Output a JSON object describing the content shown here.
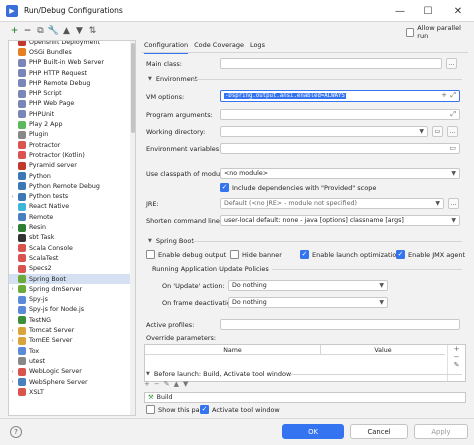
{
  "window": {
    "title": "Run/Debug Configurations",
    "minimize": "—",
    "maximize": "☐",
    "close": "✕"
  },
  "toolbar": {
    "add": "+",
    "remove": "−",
    "copy": "⧉",
    "settings": "🔧",
    "move_up": "▲",
    "move_down": "▼",
    "sort": "⇅"
  },
  "tree": {
    "items": [
      {
        "label": "Openshift Deployment",
        "color": "#c0392b",
        "arrow": ""
      },
      {
        "label": "OSGi Bundles",
        "color": "#e67e22",
        "arrow": ""
      },
      {
        "label": "PHP Built-in Web Server",
        "color": "#7a86b8",
        "arrow": ""
      },
      {
        "label": "PHP HTTP Request",
        "color": "#7a86b8",
        "arrow": ""
      },
      {
        "label": "PHP Remote Debug",
        "color": "#7a86b8",
        "arrow": ""
      },
      {
        "label": "PHP Script",
        "color": "#7a86b8",
        "arrow": ""
      },
      {
        "label": "PHP Web Page",
        "color": "#7a86b8",
        "arrow": ""
      },
      {
        "label": "PHPUnit",
        "color": "#7a86b8",
        "arrow": ""
      },
      {
        "label": "Play 2 App",
        "color": "#5cb85c",
        "arrow": ""
      },
      {
        "label": "Plugin",
        "color": "#888888",
        "arrow": ""
      },
      {
        "label": "Protractor",
        "color": "#d9534f",
        "arrow": ""
      },
      {
        "label": "Protractor (Kotlin)",
        "color": "#d9534f",
        "arrow": ""
      },
      {
        "label": "Pyramid server",
        "color": "#c0392b",
        "arrow": ""
      },
      {
        "label": "Python",
        "color": "#3b78b5",
        "arrow": ""
      },
      {
        "label": "Python Remote Debug",
        "color": "#3b78b5",
        "arrow": ""
      },
      {
        "label": "Python tests",
        "color": "#3b78b5",
        "arrow": "›"
      },
      {
        "label": "React Native",
        "color": "#3fb6d9",
        "arrow": ""
      },
      {
        "label": "Remote",
        "color": "#4a7fbf",
        "arrow": ""
      },
      {
        "label": "Resin",
        "color": "#2e7d32",
        "arrow": "›"
      },
      {
        "label": "sbt Task",
        "color": "#333333",
        "arrow": ""
      },
      {
        "label": "Scala Console",
        "color": "#d9534f",
        "arrow": ""
      },
      {
        "label": "ScalaTest",
        "color": "#d9534f",
        "arrow": ""
      },
      {
        "label": "Specs2",
        "color": "#d9534f",
        "arrow": ""
      },
      {
        "label": "Spring Boot",
        "color": "#6aab3b",
        "arrow": "",
        "selected": true
      },
      {
        "label": "Spring dmServer",
        "color": "#6aab3b",
        "arrow": "›"
      },
      {
        "label": "Spy-js",
        "color": "#5a8ad8",
        "arrow": ""
      },
      {
        "label": "Spy-js for Node.js",
        "color": "#5a8ad8",
        "arrow": ""
      },
      {
        "label": "TestNG",
        "color": "#3b8f3b",
        "arrow": ""
      },
      {
        "label": "Tomcat Server",
        "color": "#d9a43b",
        "arrow": "›"
      },
      {
        "label": "TomEE Server",
        "color": "#d9a43b",
        "arrow": "›"
      },
      {
        "label": "Tox",
        "color": "#5a8ad8",
        "arrow": ""
      },
      {
        "label": "utest",
        "color": "#888888",
        "arrow": ""
      },
      {
        "label": "WebLogic Server",
        "color": "#d9534f",
        "arrow": "›"
      },
      {
        "label": "WebSphere Server",
        "color": "#4a7fbf",
        "arrow": "›"
      },
      {
        "label": "XSLT",
        "color": "#d9534f",
        "arrow": ""
      }
    ]
  },
  "header": {
    "allow_parallel_run": "Allow parallel run"
  },
  "tabs": [
    {
      "label": "Configuration",
      "active": true
    },
    {
      "label": "Code Coverage",
      "active": false
    },
    {
      "label": "Logs",
      "active": false
    }
  ],
  "form": {
    "main_class_label": "Main class:",
    "main_class_btn": "…",
    "environment_label": "Environment",
    "vm_options_label": "VM options:",
    "vm_options_value": "-Dspring.output.ansi.enabled=ALWAYS",
    "vm_plus": "+",
    "vm_expand": "⤢",
    "program_args_label": "Program arguments:",
    "working_dir_label": "Working directory:",
    "env_vars_label": "Environment variables:",
    "classpath_label": "Use classpath of module:",
    "classpath_value": "<no module>",
    "include_deps_label": "Include dependencies with \"Provided\" scope",
    "jre_label": "JRE:",
    "jre_value": "Default (<no JRE> - module not specified)",
    "shorten_label": "Shorten command line:",
    "shorten_value": "user-local default: none - java [options] classname [args]",
    "folder_btn": "▭",
    "dots_btn": "…",
    "expand_icon": "⤢"
  },
  "spring_boot": {
    "section_label": "Spring Boot",
    "enable_debug_output": "Enable debug output",
    "hide_banner": "Hide banner",
    "enable_launch_optimization": "Enable launch optimization",
    "enable_jmx_agent": "Enable JMX agent",
    "running_policies_label": "Running Application Update Policies",
    "on_update_label": "On 'Update' action:",
    "on_update_value": "Do nothing",
    "on_frame_label": "On frame deactivation:",
    "on_frame_value": "Do nothing",
    "active_profiles_label": "Active profiles:",
    "override_params_label": "Override parameters:",
    "col_name": "Name",
    "col_value": "Value"
  },
  "before_launch": {
    "label": "Before launch: Build, Activate tool window",
    "tools": [
      "+",
      "−",
      "✎",
      "▲",
      "▼"
    ],
    "item": "Build",
    "show_this_page": "Show this page",
    "activate_tool_window": "Activate tool window"
  },
  "footer": {
    "help": "?",
    "ok": "OK",
    "cancel": "Cancel",
    "apply": "Apply"
  },
  "colors": {
    "accent": "#3574f0",
    "selection": "#d5e1f2"
  }
}
